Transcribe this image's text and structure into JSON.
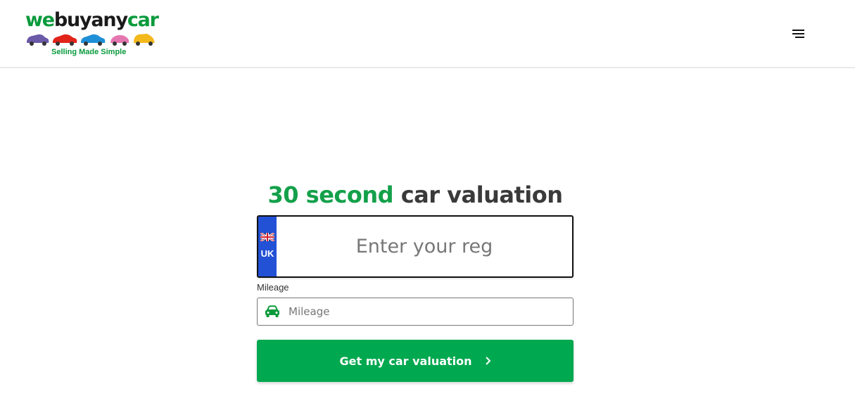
{
  "header": {
    "logo": {
      "word_part1": "we",
      "word_part2": "buyany",
      "word_part3": "car",
      "tagline": "Selling Made Simple"
    },
    "menu_icon": "hamburger-menu-icon"
  },
  "valuation": {
    "headline_highlight": "30 second",
    "headline_rest": "car valuation",
    "reg": {
      "country_code": "UK",
      "placeholder": "Enter your reg",
      "value": ""
    },
    "mileage": {
      "label": "Mileage",
      "placeholder": "Mileage",
      "value": ""
    },
    "submit_label": "Get my car valuation"
  },
  "colors": {
    "brand_green": "#00a84f",
    "plate_blue": "#2351d6",
    "text_dark": "#3a3a3a"
  }
}
